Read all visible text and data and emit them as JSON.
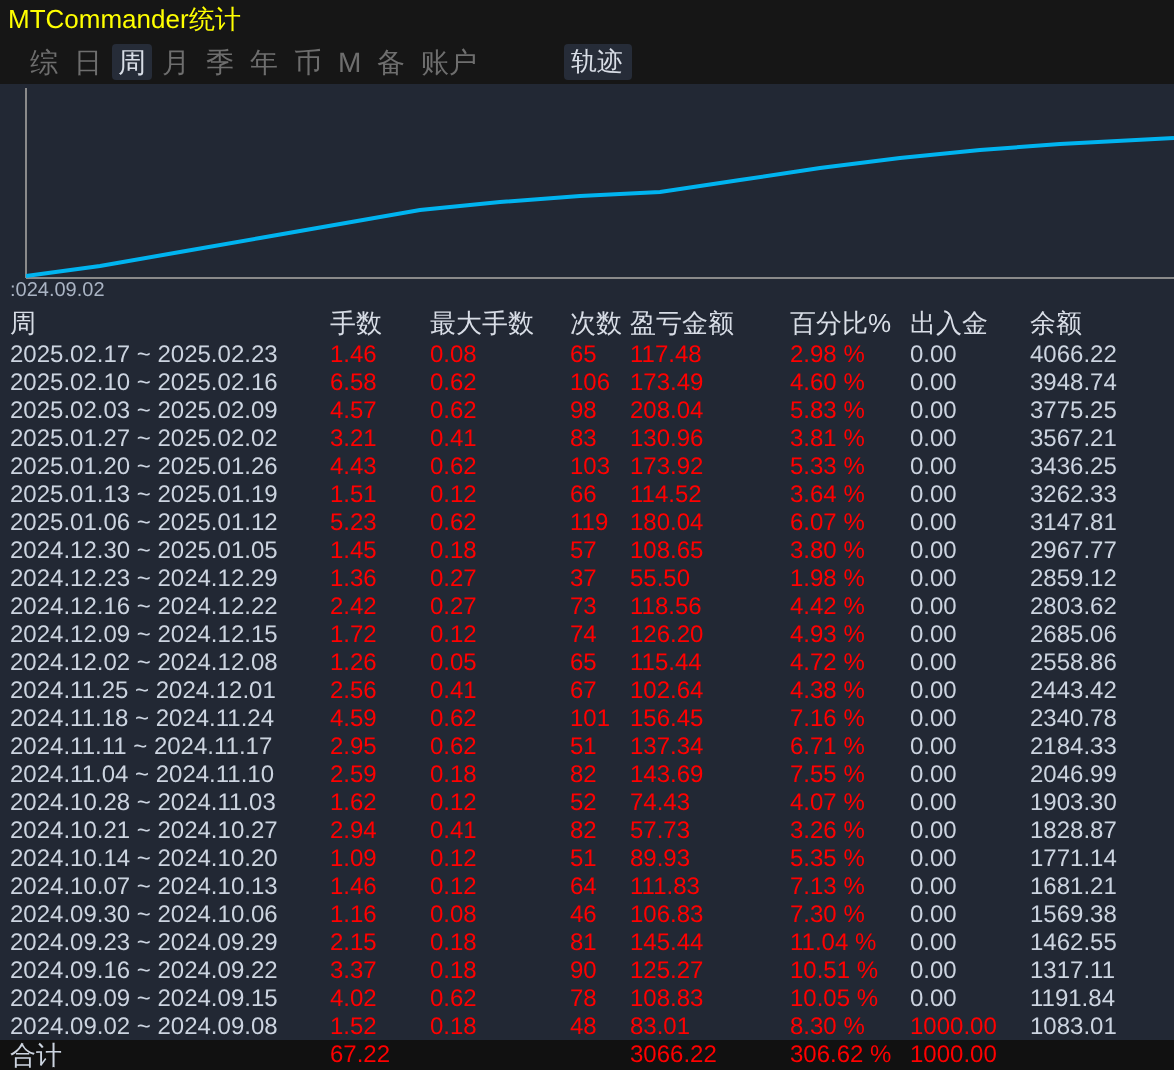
{
  "window": {
    "title": "MTCommander统计"
  },
  "tabs": [
    {
      "label": "综",
      "selected": false
    },
    {
      "label": "日",
      "selected": false
    },
    {
      "label": "周",
      "selected": true
    },
    {
      "label": "月",
      "selected": false
    },
    {
      "label": "季",
      "selected": false
    },
    {
      "label": "年",
      "selected": false
    },
    {
      "label": "币",
      "selected": false
    },
    {
      "label": "M",
      "selected": false
    },
    {
      "label": "备",
      "selected": false
    },
    {
      "label": "账户",
      "selected": false
    }
  ],
  "views": [
    {
      "label": "轨迹",
      "selected": true
    }
  ],
  "chart": {
    "start_label": ":024.09.02"
  },
  "table": {
    "columns": [
      "周",
      "手数",
      "最大手数",
      "次数",
      "盈亏金额",
      "百分比%",
      "出入金",
      "余额"
    ],
    "rows": [
      {
        "period": "2025.02.17 ~ 2025.02.23",
        "lots": "1.46",
        "max_lots": "0.08",
        "count": "65",
        "profit": "117.48",
        "percent": "2.98 %",
        "deposit": "0.00",
        "deposit_flagged": false,
        "balance": "4066.22"
      },
      {
        "period": "2025.02.10 ~ 2025.02.16",
        "lots": "6.58",
        "max_lots": "0.62",
        "count": "106",
        "profit": "173.49",
        "percent": "4.60 %",
        "deposit": "0.00",
        "deposit_flagged": false,
        "balance": "3948.74"
      },
      {
        "period": "2025.02.03 ~ 2025.02.09",
        "lots": "4.57",
        "max_lots": "0.62",
        "count": "98",
        "profit": "208.04",
        "percent": "5.83 %",
        "deposit": "0.00",
        "deposit_flagged": false,
        "balance": "3775.25"
      },
      {
        "period": "2025.01.27 ~ 2025.02.02",
        "lots": "3.21",
        "max_lots": "0.41",
        "count": "83",
        "profit": "130.96",
        "percent": "3.81 %",
        "deposit": "0.00",
        "deposit_flagged": false,
        "balance": "3567.21"
      },
      {
        "period": "2025.01.20 ~ 2025.01.26",
        "lots": "4.43",
        "max_lots": "0.62",
        "count": "103",
        "profit": "173.92",
        "percent": "5.33 %",
        "deposit": "0.00",
        "deposit_flagged": false,
        "balance": "3436.25"
      },
      {
        "period": "2025.01.13 ~ 2025.01.19",
        "lots": "1.51",
        "max_lots": "0.12",
        "count": "66",
        "profit": "114.52",
        "percent": "3.64 %",
        "deposit": "0.00",
        "deposit_flagged": false,
        "balance": "3262.33"
      },
      {
        "period": "2025.01.06 ~ 2025.01.12",
        "lots": "5.23",
        "max_lots": "0.62",
        "count": "119",
        "profit": "180.04",
        "percent": "6.07 %",
        "deposit": "0.00",
        "deposit_flagged": false,
        "balance": "3147.81"
      },
      {
        "period": "2024.12.30 ~ 2025.01.05",
        "lots": "1.45",
        "max_lots": "0.18",
        "count": "57",
        "profit": "108.65",
        "percent": "3.80 %",
        "deposit": "0.00",
        "deposit_flagged": false,
        "balance": "2967.77"
      },
      {
        "period": "2024.12.23 ~ 2024.12.29",
        "lots": "1.36",
        "max_lots": "0.27",
        "count": "37",
        "profit": "55.50",
        "percent": "1.98 %",
        "deposit": "0.00",
        "deposit_flagged": false,
        "balance": "2859.12"
      },
      {
        "period": "2024.12.16 ~ 2024.12.22",
        "lots": "2.42",
        "max_lots": "0.27",
        "count": "73",
        "profit": "118.56",
        "percent": "4.42 %",
        "deposit": "0.00",
        "deposit_flagged": false,
        "balance": "2803.62"
      },
      {
        "period": "2024.12.09 ~ 2024.12.15",
        "lots": "1.72",
        "max_lots": "0.12",
        "count": "74",
        "profit": "126.20",
        "percent": "4.93 %",
        "deposit": "0.00",
        "deposit_flagged": false,
        "balance": "2685.06"
      },
      {
        "period": "2024.12.02 ~ 2024.12.08",
        "lots": "1.26",
        "max_lots": "0.05",
        "count": "65",
        "profit": "115.44",
        "percent": "4.72 %",
        "deposit": "0.00",
        "deposit_flagged": false,
        "balance": "2558.86"
      },
      {
        "period": "2024.11.25 ~ 2024.12.01",
        "lots": "2.56",
        "max_lots": "0.41",
        "count": "67",
        "profit": "102.64",
        "percent": "4.38 %",
        "deposit": "0.00",
        "deposit_flagged": false,
        "balance": "2443.42"
      },
      {
        "period": "2024.11.18 ~ 2024.11.24",
        "lots": "4.59",
        "max_lots": "0.62",
        "count": "101",
        "profit": "156.45",
        "percent": "7.16 %",
        "deposit": "0.00",
        "deposit_flagged": false,
        "balance": "2340.78"
      },
      {
        "period": "2024.11.11 ~ 2024.11.17",
        "lots": "2.95",
        "max_lots": "0.62",
        "count": "51",
        "profit": "137.34",
        "percent": "6.71 %",
        "deposit": "0.00",
        "deposit_flagged": false,
        "balance": "2184.33"
      },
      {
        "period": "2024.11.04 ~ 2024.11.10",
        "lots": "2.59",
        "max_lots": "0.18",
        "count": "82",
        "profit": "143.69",
        "percent": "7.55 %",
        "deposit": "0.00",
        "deposit_flagged": false,
        "balance": "2046.99"
      },
      {
        "period": "2024.10.28 ~ 2024.11.03",
        "lots": "1.62",
        "max_lots": "0.12",
        "count": "52",
        "profit": "74.43",
        "percent": "4.07 %",
        "deposit": "0.00",
        "deposit_flagged": false,
        "balance": "1903.30"
      },
      {
        "period": "2024.10.21 ~ 2024.10.27",
        "lots": "2.94",
        "max_lots": "0.41",
        "count": "82",
        "profit": "57.73",
        "percent": "3.26 %",
        "deposit": "0.00",
        "deposit_flagged": false,
        "balance": "1828.87"
      },
      {
        "period": "2024.10.14 ~ 2024.10.20",
        "lots": "1.09",
        "max_lots": "0.12",
        "count": "51",
        "profit": "89.93",
        "percent": "5.35 %",
        "deposit": "0.00",
        "deposit_flagged": false,
        "balance": "1771.14"
      },
      {
        "period": "2024.10.07 ~ 2024.10.13",
        "lots": "1.46",
        "max_lots": "0.12",
        "count": "64",
        "profit": "111.83",
        "percent": "7.13 %",
        "deposit": "0.00",
        "deposit_flagged": false,
        "balance": "1681.21"
      },
      {
        "period": "2024.09.30 ~ 2024.10.06",
        "lots": "1.16",
        "max_lots": "0.08",
        "count": "46",
        "profit": "106.83",
        "percent": "7.30 %",
        "deposit": "0.00",
        "deposit_flagged": false,
        "balance": "1569.38"
      },
      {
        "period": "2024.09.23 ~ 2024.09.29",
        "lots": "2.15",
        "max_lots": "0.18",
        "count": "81",
        "profit": "145.44",
        "percent": "11.04 %",
        "deposit": "0.00",
        "deposit_flagged": false,
        "balance": "1462.55"
      },
      {
        "period": "2024.09.16 ~ 2024.09.22",
        "lots": "3.37",
        "max_lots": "0.18",
        "count": "90",
        "profit": "125.27",
        "percent": "10.51 %",
        "deposit": "0.00",
        "deposit_flagged": false,
        "balance": "1317.11"
      },
      {
        "period": "2024.09.09 ~ 2024.09.15",
        "lots": "4.02",
        "max_lots": "0.62",
        "count": "78",
        "profit": "108.83",
        "percent": "10.05 %",
        "deposit": "0.00",
        "deposit_flagged": false,
        "balance": "1191.84"
      },
      {
        "period": "2024.09.02 ~ 2024.09.08",
        "lots": "1.52",
        "max_lots": "0.18",
        "count": "48",
        "profit": "83.01",
        "percent": "8.30 %",
        "deposit": "1000.00",
        "deposit_flagged": true,
        "balance": "1083.01"
      }
    ],
    "total": {
      "label": "合计",
      "lots": "67.22",
      "profit": "3066.22",
      "percent": "306.62 %",
      "deposit": "1000.00"
    }
  }
}
